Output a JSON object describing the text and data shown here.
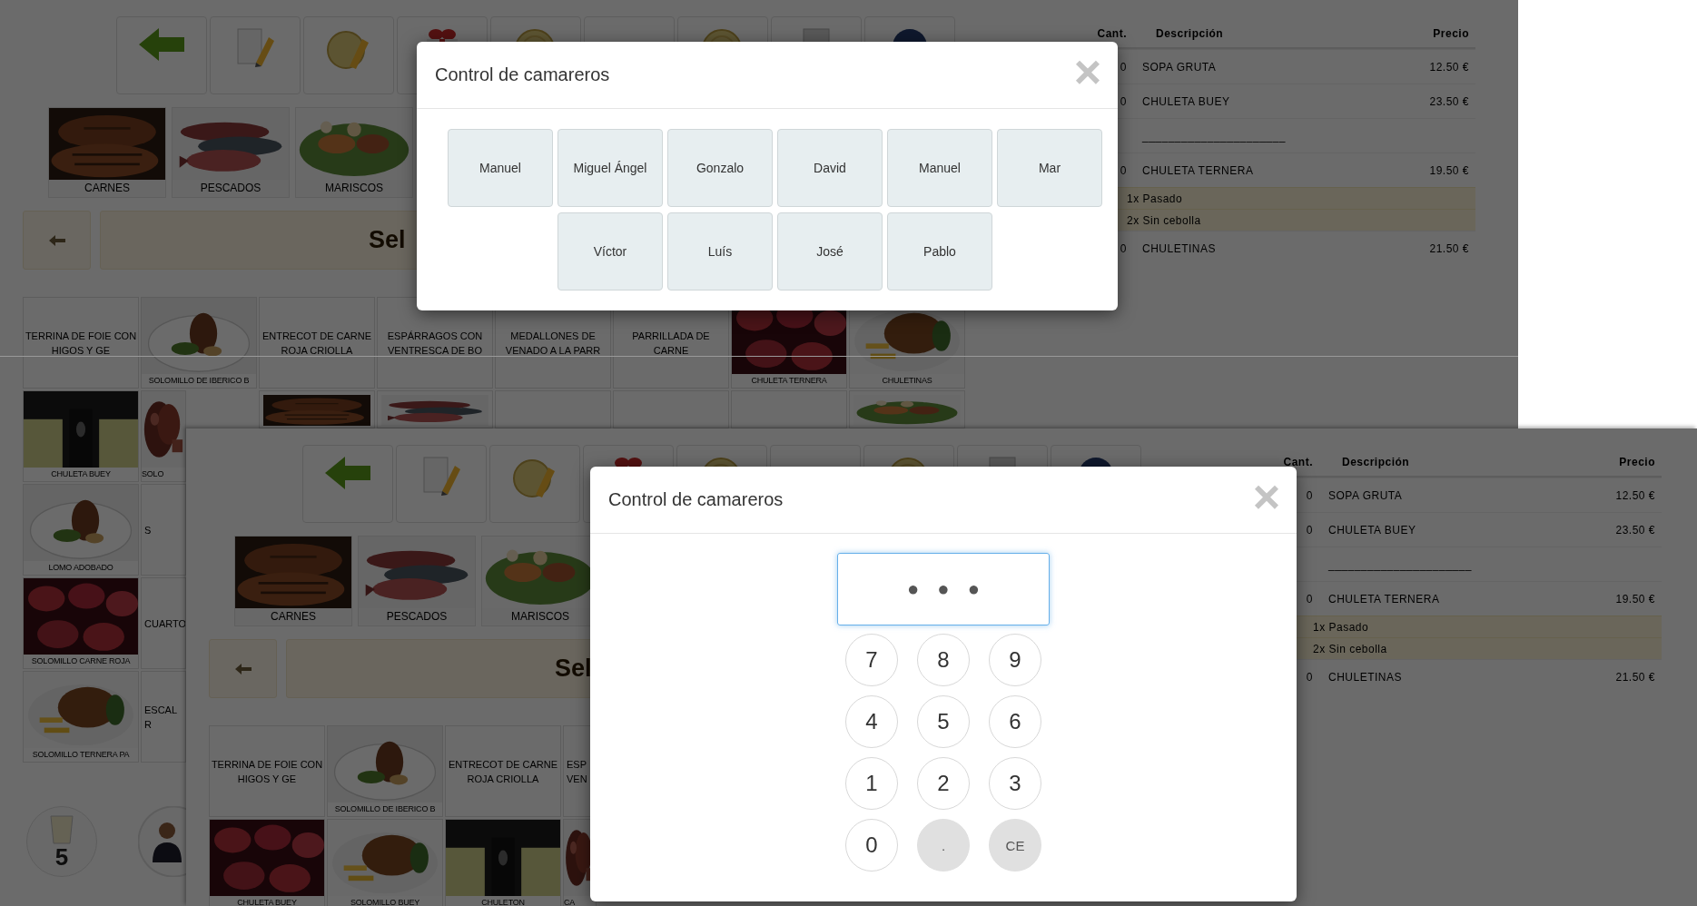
{
  "screens": [
    {
      "categories": [
        "CARNES",
        "PESCADOS",
        "MARISCOS"
      ],
      "selection_bar": {
        "title": "Sel"
      },
      "product_rows": [
        [
          {
            "kind": "text",
            "label": "TERRINA DE FOIE CON HIGOS Y GE"
          },
          {
            "kind": "picture",
            "label": "SOLOMILLO DE IBERICO B"
          },
          {
            "kind": "text",
            "label": "ENTRECOT DE CARNE ROJA CRIOLLA"
          },
          {
            "kind": "text",
            "label": "ESPÁRRAGOS CON VENTRESCA DE BO"
          },
          {
            "kind": "text",
            "label": "MEDALLONES DE VENADO A LA PARR"
          },
          {
            "kind": "text",
            "label": "PARRILLADA DE CARNE"
          },
          {
            "kind": "picture",
            "label": "CHULETA TERNERA"
          },
          {
            "kind": "picture",
            "label": "CHULETINAS"
          }
        ],
        [
          {
            "kind": "picture",
            "label": "CHULETA BUEY"
          },
          {
            "kind": "picture",
            "label": "SOLO",
            "cut": true
          },
          {
            "kind": "picture",
            "cut_bottom": true
          },
          {
            "kind": "picture",
            "cut_bottom": true
          },
          {
            "kind": "text",
            "cut_bottom": true
          },
          {
            "kind": "text",
            "cut_bottom": true
          },
          {
            "kind": "text",
            "cut_bottom": true
          },
          {
            "kind": "picture",
            "cut_bottom": true
          }
        ],
        [
          {
            "kind": "picture",
            "label": "LOMO ADOBADO"
          },
          {
            "kind": "text",
            "label": "S",
            "cut": true
          }
        ],
        [
          {
            "kind": "picture",
            "label": "SOLOMILLO CARNE ROJA"
          },
          {
            "kind": "text",
            "label": "CUARTO",
            "cut": true
          }
        ],
        [
          {
            "kind": "picture",
            "label": "SOLOMILLO TERNERA PA"
          },
          {
            "kind": "text",
            "label": "ESCAL R",
            "cut": true
          }
        ]
      ],
      "table_button": {
        "number": "5"
      },
      "order": {
        "columns": [
          "Cant.",
          "Descripción",
          "Precio"
        ],
        "rows": [
          {
            "kind": "item",
            "qty": "0",
            "description": "SOPA GRUTA",
            "price": "12.50 €"
          },
          {
            "kind": "item",
            "qty": "0",
            "description": "CHULETA BUEY",
            "price": "23.50 €"
          },
          {
            "kind": "separator",
            "description": "______________________"
          },
          {
            "kind": "item",
            "qty": "0",
            "description": "CHULETA TERNERA",
            "price": "19.50 €"
          },
          {
            "kind": "modifier",
            "description": "1x Pasado"
          },
          {
            "kind": "modifier",
            "description": "2x Sin cebolla"
          },
          {
            "kind": "item",
            "qty": "0",
            "description": "CHULETINAS",
            "price": "21.50 €"
          }
        ]
      },
      "dialog": {
        "kind": "waiters",
        "title": "Control de camareros",
        "close": "×",
        "waiters": [
          "Manuel",
          "Miguel Ángel",
          "Gonzalo",
          "David",
          "Manuel",
          "Mar",
          "Víctor",
          "Luís",
          "José",
          "Pablo"
        ]
      }
    },
    {
      "categories": [
        "CARNES",
        "PESCADOS",
        "MARISCOS"
      ],
      "selection_bar": {
        "title": "Sel"
      },
      "product_rows": [
        [
          {
            "kind": "text",
            "label": "TERRINA DE FOIE CON HIGOS Y GE"
          },
          {
            "kind": "picture",
            "label": "SOLOMILLO DE IBERICO B"
          },
          {
            "kind": "text",
            "label": "ENTRECOT DE CARNE ROJA CRIOLLA"
          },
          {
            "kind": "text",
            "label": "ESP VEN",
            "cut": true
          }
        ],
        [
          {
            "kind": "picture",
            "label": "CHULETA BUEY"
          },
          {
            "kind": "picture",
            "label": "SOLOMILLO BUEY"
          },
          {
            "kind": "picture",
            "label": "CHULETON"
          },
          {
            "kind": "picture",
            "label": "CA",
            "cut": true
          }
        ]
      ],
      "order": {
        "columns": [
          "Cant.",
          "Descripción",
          "Precio"
        ],
        "rows": [
          {
            "kind": "item",
            "qty": "0",
            "description": "SOPA GRUTA",
            "price": "12.50 €"
          },
          {
            "kind": "item",
            "qty": "0",
            "description": "CHULETA BUEY",
            "price": "23.50 €"
          },
          {
            "kind": "separator",
            "description": "______________________"
          },
          {
            "kind": "item",
            "qty": "0",
            "description": "CHULETA TERNERA",
            "price": "19.50 €"
          },
          {
            "kind": "modifier",
            "description": "1x Pasado"
          },
          {
            "kind": "modifier",
            "description": "2x Sin cebolla"
          },
          {
            "kind": "item",
            "qty": "0",
            "description": "CHULETINAS",
            "price": "21.50 €"
          }
        ]
      },
      "dialog": {
        "kind": "pin",
        "title": "Control de camareros",
        "close": "×",
        "pin_field": {
          "value": "●●●",
          "focused": true
        },
        "keys": [
          {
            "kind": "digit",
            "label": "7"
          },
          {
            "kind": "digit",
            "label": "8"
          },
          {
            "kind": "digit",
            "label": "9"
          },
          {
            "kind": "digit",
            "label": "4"
          },
          {
            "kind": "digit",
            "label": "5"
          },
          {
            "kind": "digit",
            "label": "6"
          },
          {
            "kind": "digit",
            "label": "1"
          },
          {
            "kind": "digit",
            "label": "2"
          },
          {
            "kind": "digit",
            "label": "3"
          },
          {
            "kind": "digit",
            "label": "0"
          },
          {
            "kind": "action",
            "label": "."
          },
          {
            "kind": "action",
            "label": "CE"
          }
        ]
      }
    }
  ]
}
